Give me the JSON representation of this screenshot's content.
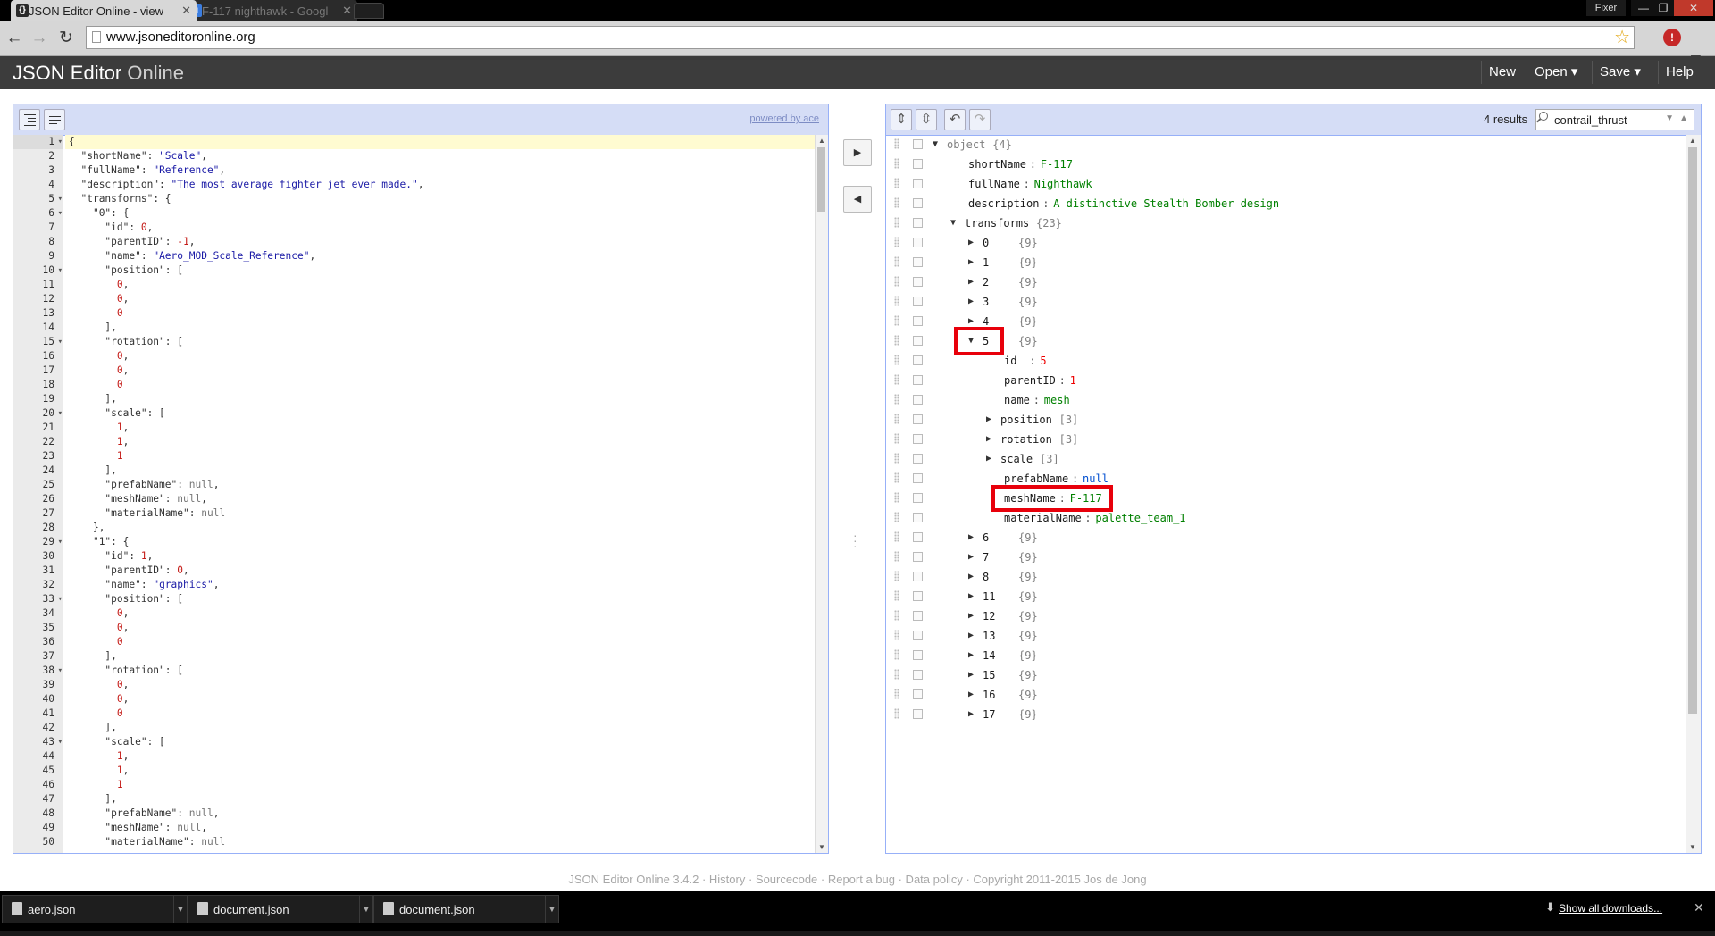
{
  "browser": {
    "tabs": [
      {
        "title": "JSON Editor Online - view",
        "favicon": "{}"
      },
      {
        "title": "F-117 nighthawk - Googl",
        "favicon": "g"
      }
    ],
    "profile_name": "Fixer",
    "url": "www.jsoneditoronline.org"
  },
  "app": {
    "brand_bold": "JSON Editor",
    "brand_light": "Online",
    "menu": {
      "new": "New",
      "open": "Open ▾",
      "save": "Save ▾",
      "help": "Help"
    }
  },
  "left_panel": {
    "powered_by": "powered by ace",
    "code": [
      {
        "n": 1,
        "t": "{",
        "fold": true
      },
      {
        "n": 2,
        "t": "  \"shortName\": \"Scale\","
      },
      {
        "n": 3,
        "t": "  \"fullName\": \"Reference\","
      },
      {
        "n": 4,
        "t": "  \"description\": \"The most average fighter jet ever made.\","
      },
      {
        "n": 5,
        "t": "  \"transforms\": {",
        "fold": true
      },
      {
        "n": 6,
        "t": "    \"0\": {",
        "fold": true
      },
      {
        "n": 7,
        "t": "      \"id\": 0,"
      },
      {
        "n": 8,
        "t": "      \"parentID\": -1,"
      },
      {
        "n": 9,
        "t": "      \"name\": \"Aero_MOD_Scale_Reference\","
      },
      {
        "n": 10,
        "t": "      \"position\": [",
        "fold": true
      },
      {
        "n": 11,
        "t": "        0,"
      },
      {
        "n": 12,
        "t": "        0,"
      },
      {
        "n": 13,
        "t": "        0"
      },
      {
        "n": 14,
        "t": "      ],"
      },
      {
        "n": 15,
        "t": "      \"rotation\": [",
        "fold": true
      },
      {
        "n": 16,
        "t": "        0,"
      },
      {
        "n": 17,
        "t": "        0,"
      },
      {
        "n": 18,
        "t": "        0"
      },
      {
        "n": 19,
        "t": "      ],"
      },
      {
        "n": 20,
        "t": "      \"scale\": [",
        "fold": true
      },
      {
        "n": 21,
        "t": "        1,"
      },
      {
        "n": 22,
        "t": "        1,"
      },
      {
        "n": 23,
        "t": "        1"
      },
      {
        "n": 24,
        "t": "      ],"
      },
      {
        "n": 25,
        "t": "      \"prefabName\": null,"
      },
      {
        "n": 26,
        "t": "      \"meshName\": null,"
      },
      {
        "n": 27,
        "t": "      \"materialName\": null"
      },
      {
        "n": 28,
        "t": "    },"
      },
      {
        "n": 29,
        "t": "    \"1\": {",
        "fold": true
      },
      {
        "n": 30,
        "t": "      \"id\": 1,"
      },
      {
        "n": 31,
        "t": "      \"parentID\": 0,"
      },
      {
        "n": 32,
        "t": "      \"name\": \"graphics\","
      },
      {
        "n": 33,
        "t": "      \"position\": [",
        "fold": true
      },
      {
        "n": 34,
        "t": "        0,"
      },
      {
        "n": 35,
        "t": "        0,"
      },
      {
        "n": 36,
        "t": "        0"
      },
      {
        "n": 37,
        "t": "      ],"
      },
      {
        "n": 38,
        "t": "      \"rotation\": [",
        "fold": true
      },
      {
        "n": 39,
        "t": "        0,"
      },
      {
        "n": 40,
        "t": "        0,"
      },
      {
        "n": 41,
        "t": "        0"
      },
      {
        "n": 42,
        "t": "      ],"
      },
      {
        "n": 43,
        "t": "      \"scale\": [",
        "fold": true
      },
      {
        "n": 44,
        "t": "        1,"
      },
      {
        "n": 45,
        "t": "        1,"
      },
      {
        "n": 46,
        "t": "        1"
      },
      {
        "n": 47,
        "t": "      ],"
      },
      {
        "n": 48,
        "t": "      \"prefabName\": null,"
      },
      {
        "n": 49,
        "t": "      \"meshName\": null,"
      },
      {
        "n": 50,
        "t": "      \"materialName\": null"
      }
    ]
  },
  "right_panel": {
    "results": "4 results",
    "search_value": "contrail_thrust",
    "tree": [
      {
        "level": 0,
        "exp": "open",
        "key": "object",
        "meta": "{4}",
        "root": true
      },
      {
        "level": 1,
        "key": "shortName",
        "val": "F-117",
        "type": "str"
      },
      {
        "level": 1,
        "key": "fullName",
        "val": "Nighthawk",
        "type": "str"
      },
      {
        "level": 1,
        "key": "description",
        "val": "A distinctive Stealth Bomber design",
        "type": "str"
      },
      {
        "level": 1,
        "exp": "open",
        "key": "transforms",
        "meta": "{23}"
      },
      {
        "level": 2,
        "exp": "closed",
        "key": "0",
        "meta": "{9}",
        "idx": true
      },
      {
        "level": 2,
        "exp": "closed",
        "key": "1",
        "meta": "{9}",
        "idx": true
      },
      {
        "level": 2,
        "exp": "closed",
        "key": "2",
        "meta": "{9}",
        "idx": true
      },
      {
        "level": 2,
        "exp": "closed",
        "key": "3",
        "meta": "{9}",
        "idx": true
      },
      {
        "level": 2,
        "exp": "closed",
        "key": "4",
        "meta": "{9}",
        "idx": true
      },
      {
        "level": 2,
        "exp": "open",
        "key": "5",
        "meta": "{9}",
        "idx": true,
        "highlight": true
      },
      {
        "level": 3,
        "key": "id",
        "val": "5",
        "type": "num",
        "pad": true
      },
      {
        "level": 3,
        "key": "parentID",
        "val": "1",
        "type": "num"
      },
      {
        "level": 3,
        "key": "name",
        "val": "mesh",
        "type": "str"
      },
      {
        "level": 3,
        "exp": "closed",
        "key": "position",
        "meta": "[3]"
      },
      {
        "level": 3,
        "exp": "closed",
        "key": "rotation",
        "meta": "[3]"
      },
      {
        "level": 3,
        "exp": "closed",
        "key": "scale",
        "meta": "[3]"
      },
      {
        "level": 3,
        "key": "prefabName",
        "val": "null",
        "type": "null"
      },
      {
        "level": 3,
        "key": "meshName",
        "val": "F-117",
        "type": "str",
        "highlight": true
      },
      {
        "level": 3,
        "key": "materialName",
        "val": "palette_team_1",
        "type": "str"
      },
      {
        "level": 2,
        "exp": "closed",
        "key": "6",
        "meta": "{9}",
        "idx": true
      },
      {
        "level": 2,
        "exp": "closed",
        "key": "7",
        "meta": "{9}",
        "idx": true
      },
      {
        "level": 2,
        "exp": "closed",
        "key": "8",
        "meta": "{9}",
        "idx": true
      },
      {
        "level": 2,
        "exp": "closed",
        "key": "11",
        "meta": "{9}",
        "idx": true
      },
      {
        "level": 2,
        "exp": "closed",
        "key": "12",
        "meta": "{9}",
        "idx": true
      },
      {
        "level": 2,
        "exp": "closed",
        "key": "13",
        "meta": "{9}",
        "idx": true
      },
      {
        "level": 2,
        "exp": "closed",
        "key": "14",
        "meta": "{9}",
        "idx": true
      },
      {
        "level": 2,
        "exp": "closed",
        "key": "15",
        "meta": "{9}",
        "idx": true
      },
      {
        "level": 2,
        "exp": "closed",
        "key": "16",
        "meta": "{9}",
        "idx": true
      },
      {
        "level": 2,
        "exp": "closed",
        "key": "17",
        "meta": "{9}",
        "idx": true
      }
    ]
  },
  "footer": {
    "text": "JSON Editor Online 3.4.2 · History · Sourcecode · Report a bug · Data policy · Copyright 2011-2015 Jos de Jong"
  },
  "downloads": {
    "items": [
      "aero.json",
      "document.json",
      "document.json"
    ],
    "show_all": "Show all downloads..."
  }
}
